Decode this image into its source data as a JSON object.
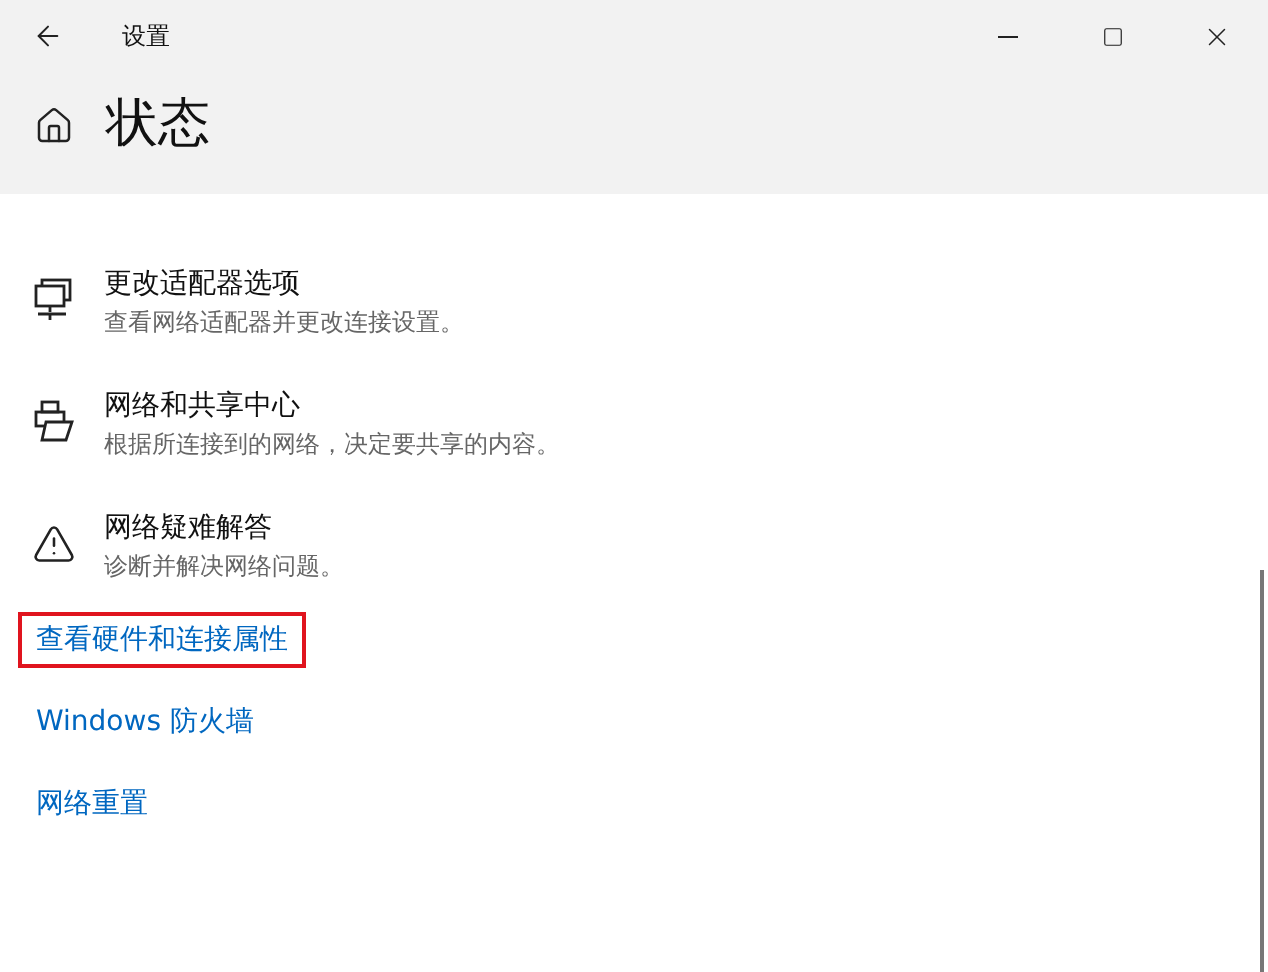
{
  "window": {
    "title": "设置"
  },
  "page": {
    "title": "状态"
  },
  "items": [
    {
      "kind": "adapter",
      "title": "更改适配器选项",
      "description": "查看网络适配器并更改连接设置。"
    },
    {
      "kind": "sharing",
      "title": "网络和共享中心",
      "description": "根据所连接到的网络，决定要共享的内容。"
    },
    {
      "kind": "troubleshoot",
      "title": "网络疑难解答",
      "description": "诊断并解决网络问题。"
    }
  ],
  "links": [
    {
      "label": "查看硬件和连接属性",
      "highlighted": true
    },
    {
      "label": "Windows 防火墙",
      "highlighted": false
    },
    {
      "label": "网络重置",
      "highlighted": false
    }
  ]
}
